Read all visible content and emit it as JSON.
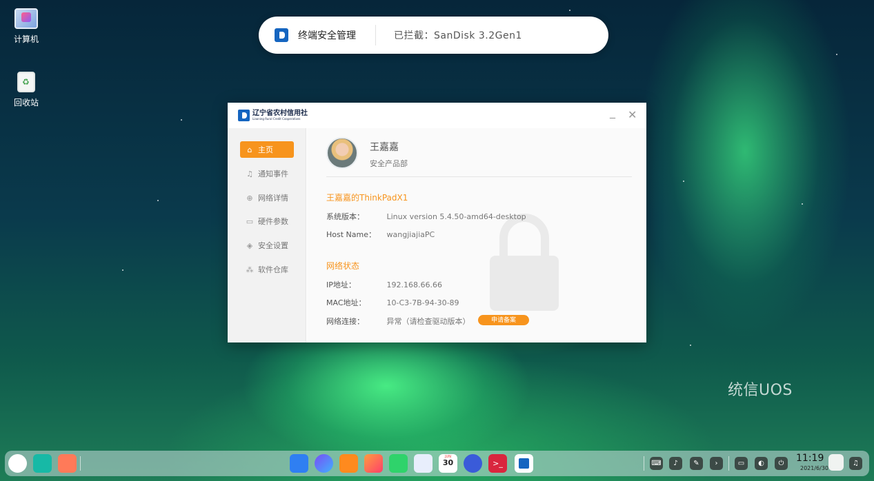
{
  "desktop": {
    "icons": [
      {
        "label": "计算机",
        "icon": "computer-icon"
      },
      {
        "label": "回收站",
        "icon": "trash-icon"
      }
    ],
    "watermark": "统信UOS"
  },
  "notification": {
    "app_name": "终端安全管理",
    "message": "已拦截：SanDisk 3.2Gen1"
  },
  "window": {
    "brand_cn": "辽宁省农村信用社",
    "brand_en": "Liaoning Rural Credit Cooperatives",
    "nav": [
      {
        "label": "主页",
        "icon": "home-icon",
        "active": true
      },
      {
        "label": "通知事件",
        "icon": "bell-icon"
      },
      {
        "label": "网络详情",
        "icon": "globe-icon"
      },
      {
        "label": "硬件参数",
        "icon": "monitor-icon"
      },
      {
        "label": "安全设置",
        "icon": "shield-icon"
      },
      {
        "label": "软件仓库",
        "icon": "apps-icon"
      }
    ],
    "user": {
      "name": "王嘉嘉",
      "department": "安全产品部"
    },
    "device_section": {
      "title": "王嘉嘉的ThinkPadX1",
      "rows": [
        {
          "key": "系统版本：",
          "value": "Linux version 5.4.50-amd64-desktop"
        },
        {
          "key": "Host Name：",
          "value": "wangjiajiaPC"
        }
      ]
    },
    "network_section": {
      "title": "网络状态",
      "rows": [
        {
          "key": "IP地址：",
          "value": "192.168.66.66"
        },
        {
          "key": "MAC地址：",
          "value": "10-C3-7B-94-30-89"
        },
        {
          "key": "网络连接：",
          "value": "异常（请检查驱动版本）"
        }
      ],
      "apply_button": "申请备案"
    }
  },
  "dock": {
    "calendar_month": "JUN",
    "calendar_day": "30",
    "clock_time": "11:19",
    "clock_date": "2021/6/30"
  },
  "colors": {
    "accent": "#f7941d",
    "brand_blue": "#1565c0"
  }
}
